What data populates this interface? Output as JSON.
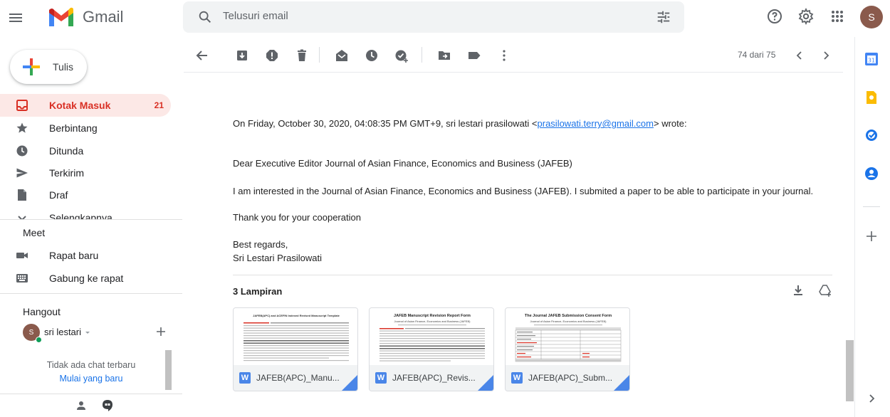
{
  "header": {
    "app_name": "Gmail",
    "search_placeholder": "Telusuri email",
    "avatar_initial": "S"
  },
  "sidebar": {
    "compose_label": "Tulis",
    "items": [
      {
        "label": "Kotak Masuk",
        "count": "21",
        "icon": "inbox-icon"
      },
      {
        "label": "Berbintang",
        "count": "",
        "icon": "star-icon"
      },
      {
        "label": "Ditunda",
        "count": "",
        "icon": "clock-icon"
      },
      {
        "label": "Terkirim",
        "count": "",
        "icon": "send-icon"
      },
      {
        "label": "Draf",
        "count": "",
        "icon": "draft-icon"
      },
      {
        "label": "Selengkapnya",
        "count": "",
        "icon": "chevron-down-icon"
      }
    ],
    "meet": {
      "title": "Meet",
      "new_meeting": "Rapat baru",
      "join_meeting": "Gabung ke rapat"
    },
    "hangout": {
      "title": "Hangout",
      "user": "sri lestari",
      "user_initial": "S",
      "no_chats": "Tidak ada chat terbaru",
      "start_new": "Mulai yang baru"
    }
  },
  "toolbar": {
    "pager": "74 dari 75"
  },
  "email": {
    "quote_prefix": "On Friday, October 30, 2020, 04:08:35 PM GMT+9, sri lestari prasilowati <",
    "quote_email": "prasilowati.terry@gmail.com",
    "quote_suffix": "> wrote:",
    "greeting": "Dear Executive Editor Journal of Asian Finance, Economics and Business (JAFEB)",
    "body": "I am interested in the Journal of Asian Finance, Economics and Business (JAFEB). I submited a paper to be able to participate in your journal.",
    "thanks": "Thank you for your cooperation",
    "closing": "Best regards,",
    "signature": "Sri Lestari Prasilowati"
  },
  "attachments": {
    "title": "3 Lampiran",
    "items": [
      {
        "name": "JAFEB(APC)_Manu...",
        "thumb_title": "JAFEB(APC) and ACEFIN Indexed Revised Manuscript Template"
      },
      {
        "name": "JAFEB(APC)_Revis...",
        "thumb_title": "JAFEB Manuscript Revision Report Form",
        "thumb_subtitle": "Journal of Asian Finance, Economics and Business (JAFEB)"
      },
      {
        "name": "JAFEB(APC)_Subm...",
        "thumb_title": "The Journal JAFEB Submission Consent Form",
        "thumb_subtitle": "Journal of Asian Finance, Economics and Business (JAFEB)"
      }
    ]
  },
  "colors": {
    "accent_red": "#d93025",
    "active_bg": "#fce8e6",
    "link_blue": "#1a73e8",
    "word_blue": "#4a86e8"
  }
}
